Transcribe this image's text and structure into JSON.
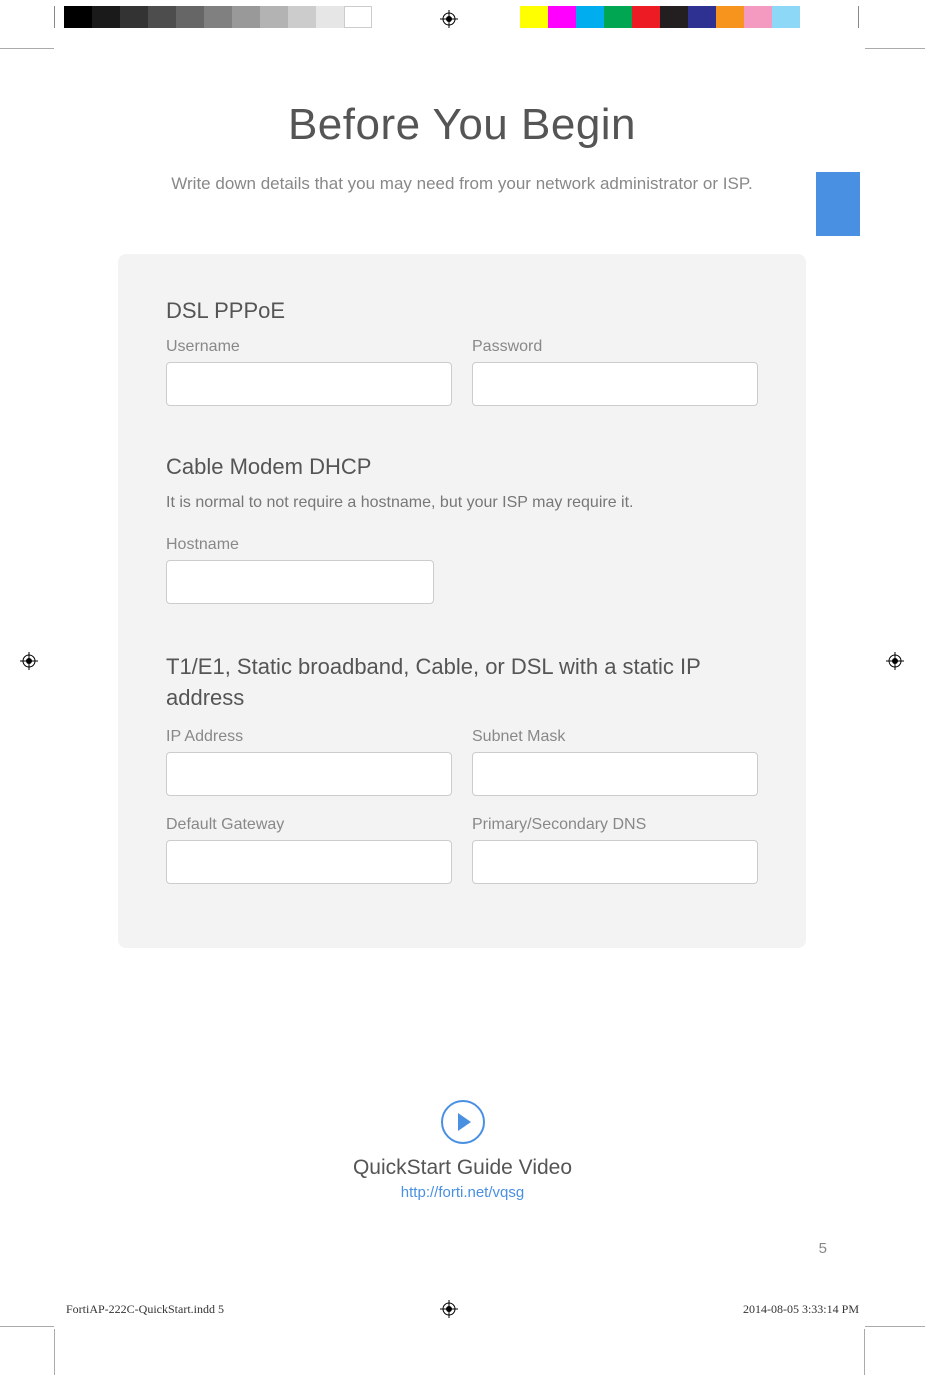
{
  "title": "Before You Begin",
  "subtitle": "Write down details that you may need from your network administrator or ISP.",
  "sections": {
    "dsl": {
      "heading": "DSL PPPoE",
      "username_label": "Username",
      "password_label": "Password"
    },
    "dhcp": {
      "heading": "Cable Modem DHCP",
      "note": "It is normal to not require a hostname, but your ISP may require it.",
      "hostname_label": "Hostname"
    },
    "static": {
      "heading": "T1/E1, Static broadband, Cable, or DSL with a static IP address",
      "ip_label": "IP Address",
      "subnet_label": "Subnet Mask",
      "gateway_label": "Default Gateway",
      "dns_label": "Primary/Secondary DNS"
    }
  },
  "video": {
    "title": "QuickStart Guide Video",
    "url": "http://forti.net/vqsg"
  },
  "page_number": "5",
  "footer": {
    "slug": "FortiAP-222C-QuickStart.indd   5",
    "date": "2014-08-05   3:33:14 PM"
  },
  "printer_marks": {
    "grays": [
      "#000000",
      "#1a1a1a",
      "#333333",
      "#4d4d4d",
      "#666666",
      "#808080",
      "#999999",
      "#b3b3b3",
      "#cccccc",
      "#e6e6e6",
      "#ffffff"
    ],
    "colors": [
      "#ffff00",
      "#ff00ff",
      "#00aeef",
      "#00a651",
      "#ed1c24",
      "#231f20",
      "#2e3192",
      "#f7941d",
      "#f49ac1",
      "#8dd7f7"
    ]
  }
}
